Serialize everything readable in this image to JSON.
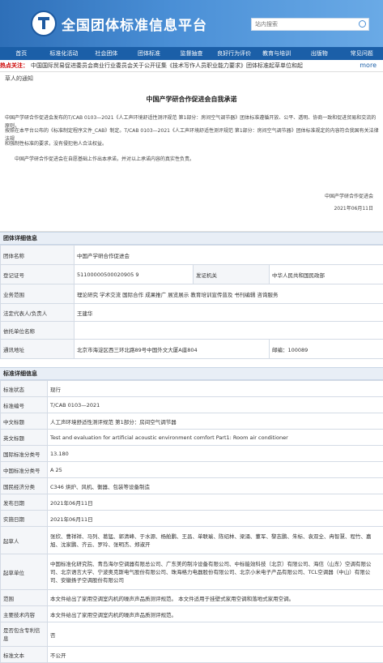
{
  "header": {
    "site_title": "全国团体标准信息平台",
    "search_placeholder": "站内搜索"
  },
  "nav": [
    "首页",
    "标准化活动",
    "社会团体",
    "团体标准",
    "监督抽查",
    "良好行为评价",
    "教育与培训",
    "出版物",
    "常见问题"
  ],
  "hot": {
    "label": "热点关注：",
    "text": "中国国际贸易促进委员会商业行业委员会关于公开征集《技术写作人员职业能力要求》团体标准起草单位和起",
    "more": "more"
  },
  "notice": {
    "suffix": "草人的通知",
    "title": "中国产学研合作促进会自我承诺",
    "para1_line1": "中国产学研合作促进会发布的T/CAB 0103—2021《人工声环境舒适性测评规范 第1部分：房间空气调节器》团体标准遵循开放、公平、透明、协商一致和促进贸易和交流的原则，",
    "para1_line2": "按照在本平台公布的《标准制定程序文件_CAB》制定。T/CAB 0103—2021《人工声环境舒适性测评规范 第1部分：房间空气调节器》团体标准规定的内容符合我国有关法律法规",
    "para1_line3": "和强制性标准的要求，没有侵犯他人合法权益。",
    "para2": "中国产学研合作促进会在自愿基础上作出本承诺，并对以上承诺内容的真实性负责。",
    "sign_org": "中国产学研合作促进会",
    "sign_date": "2021年06月11日"
  },
  "group_section": {
    "title": "团体详细信息",
    "name_label": "团体名称",
    "name": "中国产学研合作促进会",
    "reg_label": "登记证号",
    "reg": "51100000500020905 9",
    "authority_label": "发证机关",
    "authority": "中华人民共和国民政部",
    "scope_label": "业务范围",
    "scope": "理论研究 学术交流 国际合作 成果推广 展览展示 教育培训宣传普及 书刊编辑 咨询服务",
    "rep_label": "法定代表人/负责人",
    "rep": "王建华",
    "support_label": "依托单位名称",
    "support": "",
    "address_label": "通讯地址",
    "address": "北京市海淀区西三环北路89号中国外文大厦A座804",
    "postcode_label": "邮编：",
    "postcode": "100089"
  },
  "standard_section": {
    "title": "标准详细信息",
    "rows": [
      {
        "label": "标准状态",
        "value": "现行"
      },
      {
        "label": "标准编号",
        "value": "T/CAB 0103—2021"
      },
      {
        "label": "中文标题",
        "value": "人工声环境舒适性测评规范 第1部分：房间空气调节器"
      },
      {
        "label": "英文标题",
        "value": "Test and evaluation for artificial acoustic environment comfort Part1: Room air conditioner"
      },
      {
        "label": "国际标准分类号",
        "value": "13.180"
      },
      {
        "label": "中国标准分类号",
        "value": "A 25"
      },
      {
        "label": "国民经济分类",
        "value": "C346 烘炉、风机、衡器、包装等设备制造"
      },
      {
        "label": "发布日期",
        "value": "2021年06月11日"
      },
      {
        "label": "实施日期",
        "value": "2021年06月11日"
      }
    ],
    "drafters_label": "起草人",
    "drafters": "张欣、曹祥祥、马列、葛猛、郭清峰、于水源、杨舱鹏、王昌、单联瑜、陈绍林、梁涌、董军、黎志鹏、朱标、袁双全、冉智慧、程竹、嘉旭、沈家鹏、齐云、罗玲、张明杰、郑淑开",
    "units_label": "起草单位",
    "units": "中国标准化研究院、青岛海尔空调器有限总公司、广东美的制冷设备有限公司、中标能效科技（北京）有限公司、海信（山东）空调有限公司、北京语言大学、宁波奥克斯电气股份有限公司、珠海格力电器股份有限公司、北京小米电子产品有限公司、TCL空调器（中山）有限公司、安徽扬子空调股份有限公司",
    "range_label": "范围",
    "range": "本文件给出了家用空调室内机的噪声声品质测评规范。 本文件适用于挂壁式家用空调和落地式家用空调。",
    "content_label": "主要技术内容",
    "content": "本文件给出了家用空调室内机的噪声声品质测评规范。",
    "patent_label": "是否包含专利信息",
    "patent": "否",
    "text_label": "标准文本",
    "text": "不公开"
  }
}
